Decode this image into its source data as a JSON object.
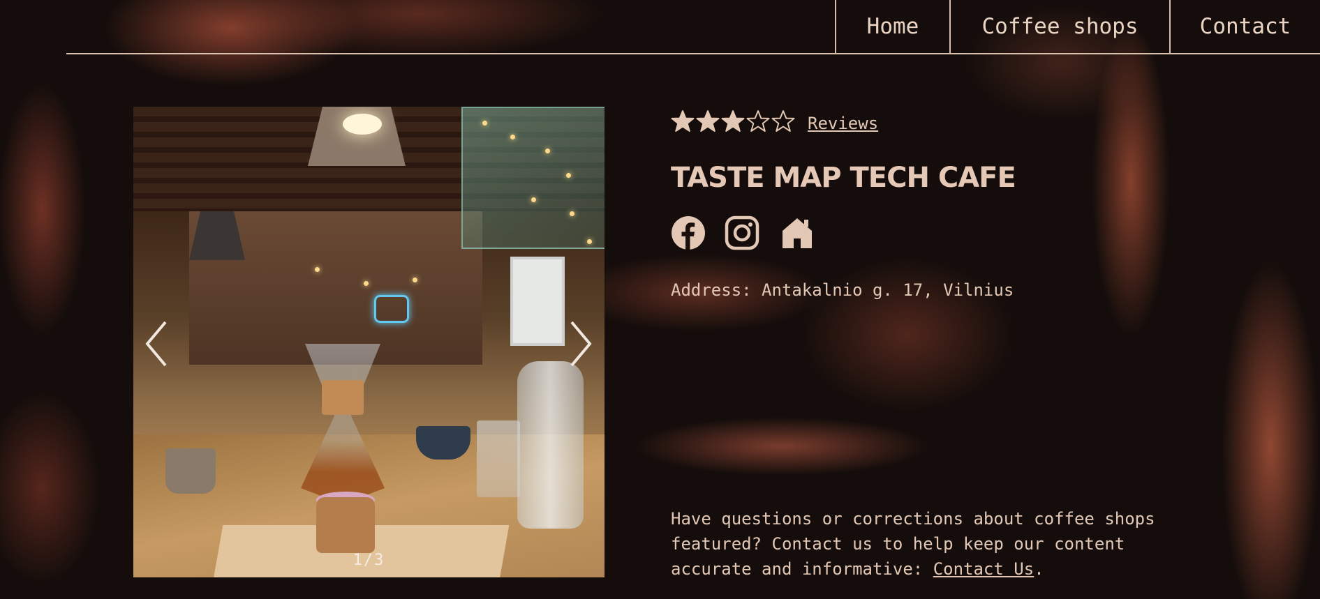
{
  "nav": {
    "items": [
      {
        "label": "Home"
      },
      {
        "label": "Coffee shops"
      },
      {
        "label": "Contact"
      }
    ]
  },
  "gallery": {
    "counter": "1/3",
    "current": 1,
    "total": 3,
    "prev_icon": "chevron-left-icon",
    "next_icon": "chevron-right-icon"
  },
  "shop": {
    "rating": 3,
    "rating_max": 5,
    "reviews_label": "Reviews",
    "name": "TASTE MAP TECH CAFE",
    "social_icons": [
      "facebook-icon",
      "instagram-icon",
      "home-icon"
    ],
    "address": "Address: Antakalnio g. 17, Vilnius"
  },
  "contact_note": {
    "text": "Have questions or corrections about coffee shops featured? Contact us to help keep our content accurate and informative: ",
    "link_label": "Contact Us",
    "suffix": "."
  },
  "colors": {
    "text": "#e3c8b6",
    "background": "#140d0b",
    "accent_rust": "#a5503c"
  }
}
